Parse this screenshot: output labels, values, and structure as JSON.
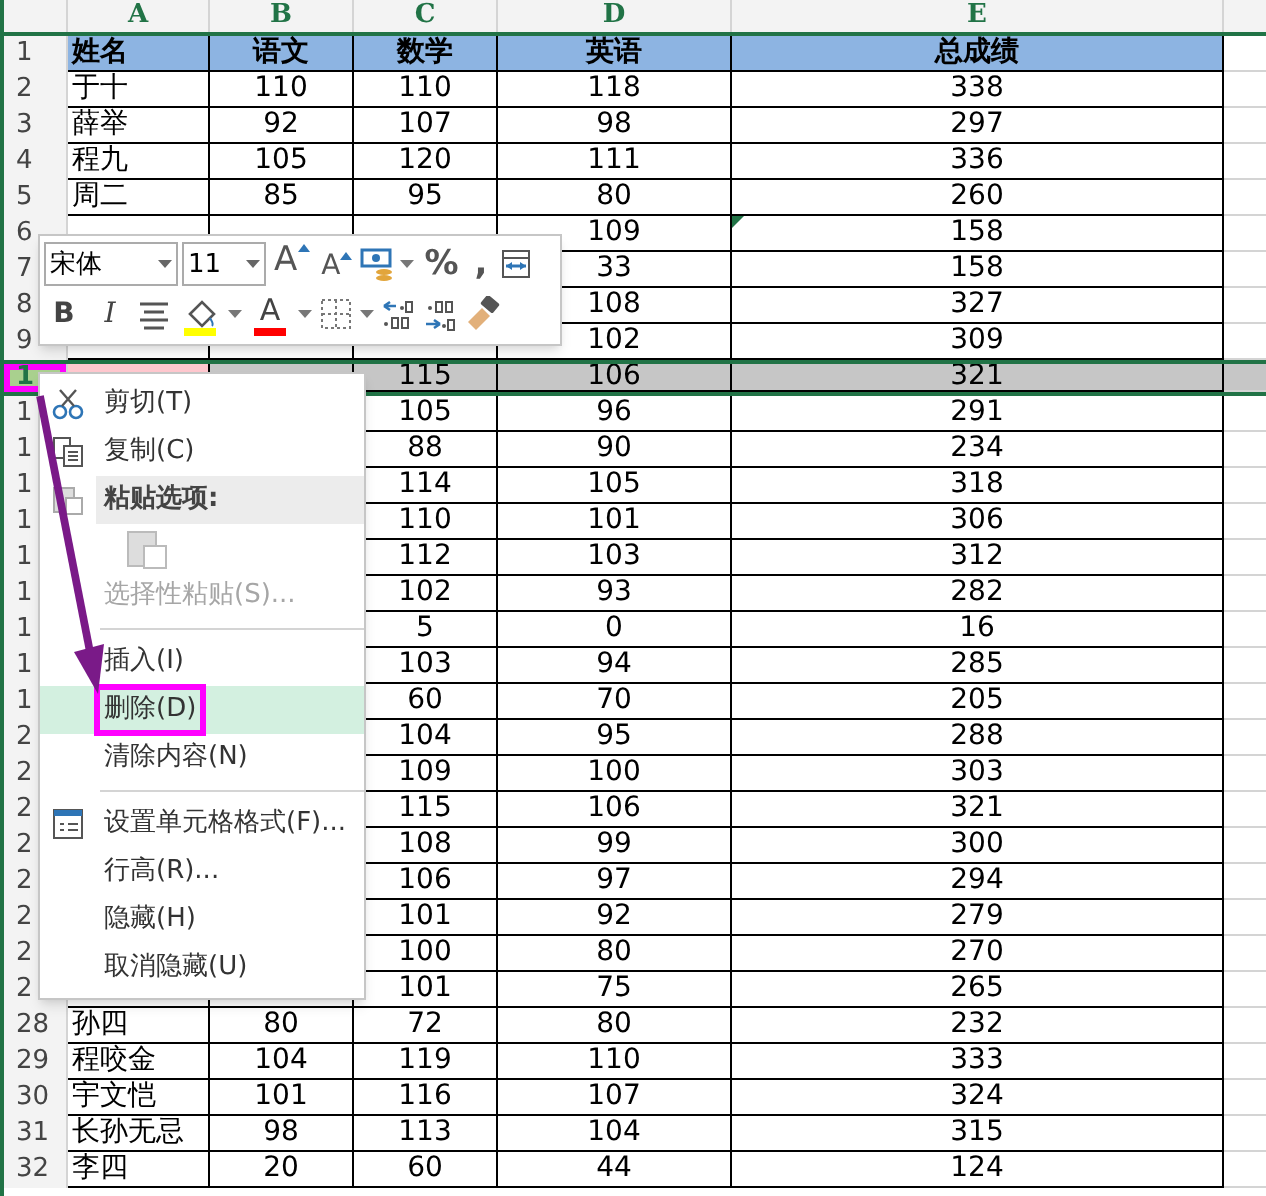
{
  "columns": [
    "A",
    "B",
    "C",
    "D",
    "E"
  ],
  "rows": [
    {
      "number": "1",
      "kind": "header",
      "selected": false,
      "cells": [
        "姓名",
        "语文",
        "数学",
        "英语",
        "总成绩"
      ]
    },
    {
      "number": "2",
      "kind": "data",
      "selected": false,
      "cells": [
        "于十",
        "110",
        "110",
        "118",
        "338"
      ]
    },
    {
      "number": "3",
      "kind": "data",
      "selected": false,
      "cells": [
        "薛举",
        "92",
        "107",
        "98",
        "297"
      ]
    },
    {
      "number": "4",
      "kind": "data",
      "selected": false,
      "cells": [
        "程九",
        "105",
        "120",
        "111",
        "336"
      ]
    },
    {
      "number": "5",
      "kind": "data",
      "selected": false,
      "cells": [
        "周二",
        "85",
        "95",
        "80",
        "260"
      ]
    },
    {
      "number": "6",
      "kind": "data",
      "selected": false,
      "cells": [
        {},
        {},
        {},
        "109",
        {
          "text": "158",
          "flagged": true
        }
      ]
    },
    {
      "number": "7",
      "kind": "data",
      "selected": false,
      "cells": [
        null,
        null,
        null,
        "33",
        "158"
      ]
    },
    {
      "number": "8",
      "kind": "data",
      "selected": false,
      "cells": [
        null,
        null,
        null,
        "108",
        "327"
      ]
    },
    {
      "number": "9",
      "kind": "data",
      "selected": false,
      "cells": [
        {},
        {},
        {},
        "102",
        "309"
      ]
    },
    {
      "number": "1",
      "kind": "data",
      "selected": true,
      "marked": true,
      "cells": [
        {
          "highlighted": true
        },
        {},
        "115",
        "106",
        "321"
      ]
    },
    {
      "number": "1",
      "kind": "data",
      "selected": false,
      "cells": [
        null,
        null,
        "105",
        "96",
        "291"
      ]
    },
    {
      "number": "1",
      "kind": "data",
      "selected": false,
      "cells": [
        null,
        null,
        "88",
        "90",
        "234"
      ]
    },
    {
      "number": "1",
      "kind": "data",
      "selected": false,
      "cells": [
        null,
        null,
        "114",
        "105",
        "318"
      ]
    },
    {
      "number": "1",
      "kind": "data",
      "selected": false,
      "cells": [
        null,
        null,
        "110",
        "101",
        "306"
      ]
    },
    {
      "number": "1",
      "kind": "data",
      "selected": false,
      "cells": [
        null,
        null,
        "112",
        "103",
        "312"
      ]
    },
    {
      "number": "1",
      "kind": "data",
      "selected": false,
      "cells": [
        null,
        null,
        "102",
        "93",
        "282"
      ]
    },
    {
      "number": "1",
      "kind": "data",
      "selected": false,
      "cells": [
        null,
        null,
        "5",
        "0",
        "16"
      ]
    },
    {
      "number": "1",
      "kind": "data",
      "selected": false,
      "cells": [
        null,
        null,
        "103",
        "94",
        "285"
      ]
    },
    {
      "number": "1",
      "kind": "data",
      "selected": false,
      "cells": [
        null,
        null,
        "60",
        "70",
        "205"
      ]
    },
    {
      "number": "2",
      "kind": "data",
      "selected": false,
      "cells": [
        null,
        null,
        "104",
        "95",
        "288"
      ]
    },
    {
      "number": "2",
      "kind": "data",
      "selected": false,
      "cells": [
        null,
        null,
        "109",
        "100",
        "303"
      ]
    },
    {
      "number": "2",
      "kind": "data",
      "selected": false,
      "cells": [
        null,
        null,
        "115",
        "106",
        "321"
      ]
    },
    {
      "number": "2",
      "kind": "data",
      "selected": false,
      "cells": [
        null,
        null,
        "108",
        "99",
        "300"
      ]
    },
    {
      "number": "2",
      "kind": "data",
      "selected": false,
      "cells": [
        null,
        null,
        "106",
        "97",
        "294"
      ]
    },
    {
      "number": "2",
      "kind": "data",
      "selected": false,
      "cells": [
        null,
        null,
        "101",
        "92",
        "279"
      ]
    },
    {
      "number": "2",
      "kind": "data",
      "selected": false,
      "cells": [
        null,
        null,
        "100",
        "80",
        "270"
      ]
    },
    {
      "number": "2",
      "kind": "data",
      "selected": false,
      "cells": [
        {},
        {},
        "101",
        "75",
        "265"
      ]
    },
    {
      "number": "28",
      "kind": "data",
      "selected": false,
      "cells": [
        "孙四",
        "80",
        "72",
        "80",
        "232"
      ]
    },
    {
      "number": "29",
      "kind": "data",
      "selected": false,
      "cells": [
        "程咬金",
        "104",
        "119",
        "110",
        "333"
      ]
    },
    {
      "number": "30",
      "kind": "data",
      "selected": false,
      "cells": [
        "宇文恺",
        "101",
        "116",
        "107",
        "324"
      ]
    },
    {
      "number": "31",
      "kind": "data",
      "selected": false,
      "cells": [
        "长孙无忌",
        "98",
        "113",
        "104",
        "315"
      ]
    },
    {
      "number": "32",
      "kind": "data",
      "selected": false,
      "cells": [
        "李四",
        "20",
        "60",
        "44",
        "124"
      ]
    }
  ],
  "mini_toolbar": {
    "font": "宋体",
    "size": "11",
    "row_1": [
      {
        "kind": "grow",
        "label": "A"
      },
      {
        "kind": "shrink",
        "label": "A"
      },
      {
        "kind": "accounting"
      },
      {
        "kind": "text",
        "label": "%"
      },
      {
        "kind": "text",
        "label": ","
      },
      {
        "kind": "wrap"
      }
    ],
    "row_2": [
      {
        "kind": "bold",
        "label": "B"
      },
      {
        "kind": "italic",
        "label": "I"
      },
      {
        "kind": "align"
      },
      {
        "kind": "fill",
        "color": "#ffff00"
      },
      {
        "kind": "fontcolor",
        "label": "A",
        "color": "#ff0000"
      },
      {
        "kind": "borders"
      },
      {
        "kind": "incdec"
      },
      {
        "kind": "decdec"
      },
      {
        "kind": "painter"
      }
    ]
  },
  "context_menu": [
    {
      "kind": "cut",
      "label": "剪切(T)",
      "selected": false,
      "disabled": false,
      "marked": false
    },
    {
      "kind": "copy",
      "label": "复制(C)",
      "selected": false,
      "disabled": false,
      "marked": false
    },
    {
      "kind": "paste-header",
      "label": "粘贴选项:"
    },
    {
      "kind": "paste-option"
    },
    {
      "kind": "item",
      "label": "选择性粘贴(S)...",
      "selected": false,
      "disabled": true,
      "marked": false
    },
    {
      "kind": "separator"
    },
    {
      "kind": "item",
      "label": "插入(I)",
      "selected": false,
      "disabled": false,
      "marked": false
    },
    {
      "kind": "item",
      "label": "删除(D)",
      "selected": true,
      "disabled": false,
      "marked": true
    },
    {
      "kind": "item",
      "label": "清除内容(N)",
      "selected": false,
      "disabled": false,
      "marked": false
    },
    {
      "kind": "separator"
    },
    {
      "kind": "format",
      "label": "设置单元格格式(F)...",
      "selected": false,
      "disabled": false,
      "marked": false
    },
    {
      "kind": "item",
      "label": "行高(R)...",
      "selected": false,
      "disabled": false,
      "marked": false
    },
    {
      "kind": "item",
      "label": "隐藏(H)",
      "selected": false,
      "disabled": false,
      "marked": false
    },
    {
      "kind": "item",
      "label": "取消隐藏(U)",
      "selected": false,
      "disabled": false,
      "marked": false
    }
  ]
}
